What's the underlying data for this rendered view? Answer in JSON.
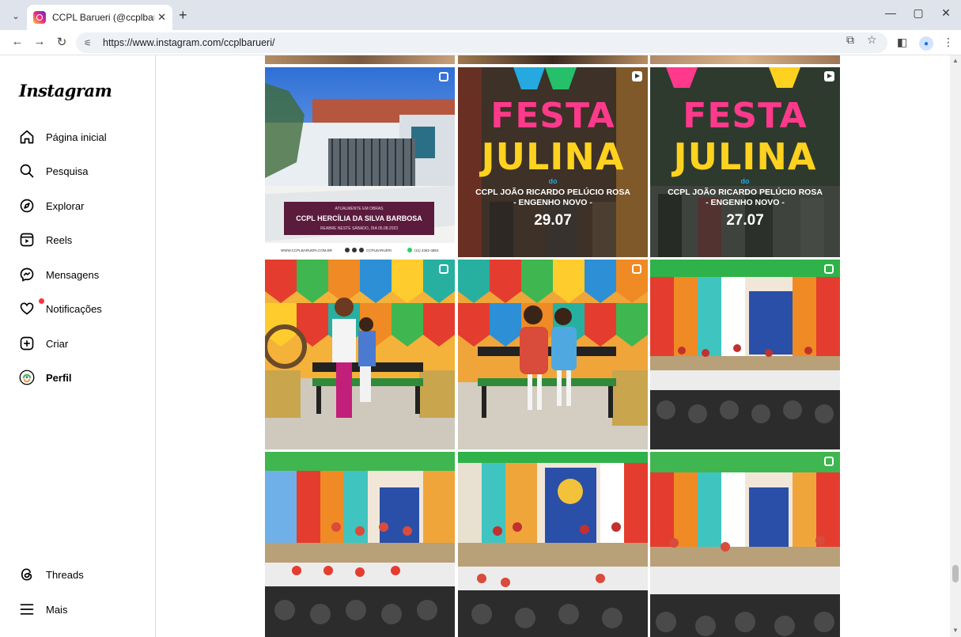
{
  "browser": {
    "tab_title": "CCPL Barueri (@ccplbarueri) • F",
    "url": "https://www.instagram.com/ccplbarueri/"
  },
  "sidebar": {
    "logo": "Instagram",
    "items": [
      {
        "label": "Página inicial",
        "icon": "home-icon"
      },
      {
        "label": "Pesquisa",
        "icon": "search-icon"
      },
      {
        "label": "Explorar",
        "icon": "compass-icon"
      },
      {
        "label": "Reels",
        "icon": "reels-icon"
      },
      {
        "label": "Mensagens",
        "icon": "messenger-icon"
      },
      {
        "label": "Notificações",
        "icon": "heart-icon"
      },
      {
        "label": "Criar",
        "icon": "plus-square-icon"
      },
      {
        "label": "Perfil",
        "icon": "avatar"
      }
    ],
    "bottom_items": [
      {
        "label": "Threads",
        "icon": "threads-icon"
      },
      {
        "label": "Mais",
        "icon": "menu-icon"
      }
    ]
  },
  "posts": [
    {
      "kind": "school-photo",
      "badge": "carousel",
      "caption_small": "ATUALMENTE EM OBRAS",
      "caption_title": "CCPL HERCÍLIA DA SILVA BARBOSA",
      "caption_sub": "REABRE NESTE SÁBADO, DIA 05.08.2023",
      "footer_site": "WWW.CCPLBARUERI.COM.BR",
      "footer_handle": "CCPLBARUERI",
      "footer_phone": "(11) 4362-4864"
    },
    {
      "kind": "poster",
      "badge": "reel",
      "line1": "FESTA",
      "line2": "JULINA",
      "do": "do",
      "school": "CCPL JOÃO RICARDO PELÚCIO ROSA",
      "unit": "- ENGENHO NOVO -",
      "date": "29.07"
    },
    {
      "kind": "poster",
      "badge": "reel",
      "line1": "FESTA",
      "line2": "JULINA",
      "do": "do",
      "school": "CCPL JOÃO RICARDO PELÚCIO ROSA",
      "unit": "- ENGENHO NOVO -",
      "date": "27.07"
    },
    {
      "kind": "photo-bench-adult",
      "badge": "carousel"
    },
    {
      "kind": "photo-bench-kids",
      "badge": "carousel"
    },
    {
      "kind": "photo-stage",
      "badge": "carousel"
    },
    {
      "kind": "photo-stage",
      "badge": "carousel"
    },
    {
      "kind": "photo-stage",
      "badge": "none"
    },
    {
      "kind": "photo-stage",
      "badge": "carousel"
    }
  ],
  "colors": {
    "poster_bg": "#4a3a2a",
    "festa_pink": "#ff3a8c",
    "festa_yellow": "#ffd21f",
    "festa_blue": "#25a9e0",
    "festa_green": "#26c06a",
    "festa_orange": "#ff8a1f",
    "notification": "#ff3040"
  }
}
